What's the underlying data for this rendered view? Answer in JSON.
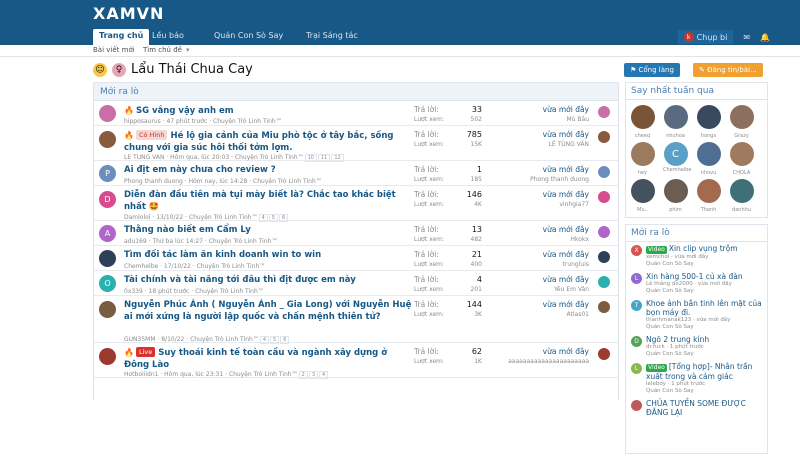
{
  "header": {
    "logo": "XAMVN"
  },
  "nav": {
    "tabs": [
      {
        "label": "Trang chủ",
        "active": true
      },
      {
        "label": "Lều báo"
      },
      {
        "label": "Quán Con Sò Say"
      },
      {
        "label": "Trại Sáng tác"
      }
    ],
    "user_initial": "k",
    "user_label": "Chụp bi"
  },
  "subnav": {
    "items": [
      "Bài viết mới",
      "Tìm chủ đề"
    ]
  },
  "page": {
    "title": "Lẩu Thái Chua Cay",
    "follow_btn": "Cổng làng",
    "post_btn": "Đăng tin/bài..."
  },
  "list": {
    "header": "Mới ra lò",
    "reply_label": "Trả lời:",
    "view_label": "Lượt xem:",
    "threads": [
      {
        "title": "SG vắng vậy anh em",
        "meta": "hipposaurus · 47 phút trước · Chuyện Trò Linh Tinh™",
        "replies": "33",
        "views": "502",
        "last": "vừa mới đây",
        "last_user": "Mù Bầu",
        "fire": true,
        "av_letter": "",
        "av_color": "#c96fa8",
        "lines": 1
      },
      {
        "title": "Hé lộ gia cảnh của Miu phò tộc ở tây bắc, sống chung với gia súc hôi thối tởm lợm.",
        "meta": "LÊ TÙNG VÂN · Hôm qua, lúc 20:03 · Chuyện Trò Linh Tinh™",
        "pages": [
          "10",
          "11",
          "12"
        ],
        "prefix": "Có Hình",
        "prefix_bg": "#f6d5d5",
        "prefix_color": "#c0392b",
        "fire": true,
        "replies": "785",
        "views": "15K",
        "last": "vừa mới đây",
        "last_user": "LÊ TÙNG VÂN",
        "av_letter": "",
        "av_color": "#8a5a3c",
        "lines": 2
      },
      {
        "title": "Ai địt em này chưa cho review ?",
        "meta": "Phong thanh duong · Hôm nay, lúc 14:28 · Chuyện Trò Linh Tinh™",
        "replies": "1",
        "views": "185",
        "last": "vừa mới đây",
        "last_user": "Phong thanh duong",
        "av_letter": "P",
        "av_color": "#6c8ebf",
        "lines": 1
      },
      {
        "title": "Diễn đàn đầu tiên mà tụi mày biết là? Chắc tao khác biệt nhất 🤩",
        "meta": "Damlolol · 13/10/22 · Chuyện Trò Linh Tinh™",
        "pages": [
          "4",
          "5",
          "6"
        ],
        "replies": "146",
        "views": "4K",
        "last": "vừa mới đây",
        "last_user": "vinhgia77",
        "av_letter": "D",
        "av_color": "#d94b8f",
        "lines": 2
      },
      {
        "title": "Thằng nào biết em Cẩm Ly",
        "meta": "adu169 · Thứ ba lúc 14:27 · Chuyện Trò Linh Tinh™",
        "replies": "13",
        "views": "482",
        "last": "vừa mới đây",
        "last_user": "Hkokx",
        "av_letter": "A",
        "av_color": "#b066c9",
        "lines": 1
      },
      {
        "title": "Tìm đối tác làm ăn kinh doanh win to win",
        "meta": "Chemhelbe · 17/10/22 · Chuyện Trò Linh Tinh™",
        "replies": "21",
        "views": "400",
        "last": "vừa mới đây",
        "last_user": "trungluis",
        "av_letter": "",
        "av_color": "#2e3f58",
        "lines": 1
      },
      {
        "title": "Tài chính và tài năng tới đâu thì địt được em này",
        "meta": "0x339 · 18 phút trước · Chuyện Trò Linh Tinh™",
        "replies": "4",
        "views": "201",
        "last": "vừa mới đây",
        "last_user": "Yêu Em Vân",
        "av_letter": "O",
        "av_color": "#2bb0b0",
        "lines": 1
      },
      {
        "title": "Nguyễn Phúc Ánh ( Nguyễn Ánh _ Gia Long) với Nguyễn Huệ ai mới xứng là người lập quốc và chấn mệnh thiên tử?",
        "meta": "GUN35MM · 8/10/22 · Chuyện Trò Linh Tinh™",
        "pages": [
          "4",
          "5",
          "6"
        ],
        "replies": "144",
        "views": "3K",
        "last": "vừa mới đây",
        "last_user": "Atlas01",
        "av_letter": "",
        "av_color": "#7a5c40",
        "lines": 3
      },
      {
        "title": "Suy thoái kinh tế toàn cầu và ngành xây dựng ở Đông Lào",
        "meta": "Hotboiiidn1 · Hôm qua, lúc 23:31 · Chuyện Trò Linh Tinh™",
        "pages": [
          "2",
          "3",
          "4"
        ],
        "prefix": "Live",
        "prefix_bg": "#d9312b",
        "prefix_color": "#ffffff",
        "fire": true,
        "replies": "62",
        "views": "1K",
        "last": "vừa mới đây",
        "last_user": "aaaaaaaaaaaaaaaaaaaaaa",
        "av_letter": "",
        "av_color": "#9a3b2e",
        "lines": 2
      }
    ]
  },
  "sidebar": {
    "members_title": "Say nhất tuần qua",
    "members": [
      {
        "name": "cheeq",
        "l": "",
        "c": "#7a5436"
      },
      {
        "name": "nhuhoa",
        "l": "",
        "c": "#5a6b80"
      },
      {
        "name": "hongs",
        "l": "",
        "c": "#394a5e"
      },
      {
        "name": "Grazy",
        "l": "",
        "c": "#8d6f5e"
      },
      {
        "name": "hey",
        "l": "",
        "c": "#9b7a5e"
      },
      {
        "name": "Chemhelbe",
        "l": "C",
        "c": "#5aa0c6"
      },
      {
        "name": "nhovu",
        "l": "",
        "c": "#4e6f92"
      },
      {
        "name": "CHOLA",
        "l": "",
        "c": "#a07a5f"
      },
      {
        "name": "Mu..",
        "l": "",
        "c": "#44525f"
      },
      {
        "name": "phim",
        "l": "",
        "c": "#6b5d52"
      },
      {
        "name": "Thanh",
        "l": "",
        "c": "#a36a4e"
      },
      {
        "name": "danhhu",
        "l": "",
        "c": "#3f6f77"
      }
    ],
    "new_title": "Mới ra lò",
    "items": [
      {
        "tag": "Video",
        "tag_bg": "#2da84a",
        "title": "Xin clip vụng trộm",
        "meta1": "xemchoi · vừa mới đây",
        "meta2": "Quán Con Sò Say",
        "l": "X",
        "c": "#d9534f"
      },
      {
        "title": "Xin hàng 500-1 củ xà đàn",
        "meta1": "Lê thắng do2000 · vừa mới đây",
        "meta2": "Quán Con Sò Say",
        "l": "L",
        "c": "#8e6bd1"
      },
      {
        "title": "Khoe ảnh bắn tinh lên mặt của bọn máy đi.",
        "meta1": "thanhmanak123 · vừa mới đây",
        "meta2": "Quán Con Sò Say",
        "l": "T",
        "c": "#45a5c9"
      },
      {
        "title": "Ngõ 2 trung kính",
        "meta1": "dr.fuck · 1 phút trước",
        "meta2": "Quán Con Sò Say",
        "l": "D",
        "c": "#56a158"
      },
      {
        "tag": "Video",
        "tag_bg": "#2da84a",
        "title": "[Tổng hợp]- Nhân trần xuất trong và cảm giác",
        "meta1": "leleboy · 1 phút trước",
        "meta2": "Quán Con Sò Say",
        "l": "L",
        "c": "#8bb84a"
      },
      {
        "title": "CHỦA TUYỀN SOME ĐƯỢC ĐĂNG LẠI",
        "meta1": "",
        "meta2": "",
        "l": "",
        "c": "#c05a5a"
      }
    ]
  }
}
